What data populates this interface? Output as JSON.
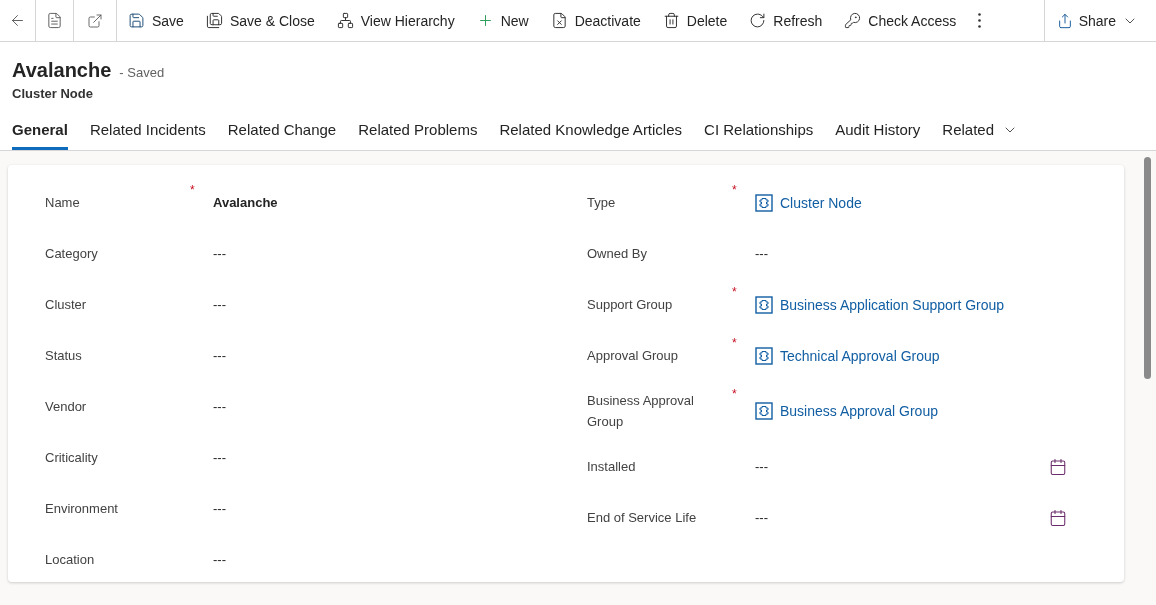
{
  "toolbar": {
    "items": [
      {
        "label": "Save"
      },
      {
        "label": "Save & Close"
      },
      {
        "label": "View Hierarchy"
      },
      {
        "label": "New"
      },
      {
        "label": "Deactivate"
      },
      {
        "label": "Delete"
      },
      {
        "label": "Refresh"
      },
      {
        "label": "Check Access"
      }
    ],
    "share": "Share"
  },
  "header": {
    "title": "Avalanche",
    "status": "- Saved",
    "entity": "Cluster Node"
  },
  "tabs": [
    {
      "label": "General",
      "selected": true
    },
    {
      "label": "Related Incidents",
      "selected": false
    },
    {
      "label": "Related Change",
      "selected": false
    },
    {
      "label": "Related Problems",
      "selected": false
    },
    {
      "label": "Related Knowledge Articles",
      "selected": false
    },
    {
      "label": "CI Relationships",
      "selected": false
    },
    {
      "label": "Audit History",
      "selected": false
    },
    {
      "label": "Related",
      "selected": false,
      "kind": "dropdown"
    }
  ],
  "form": {
    "left": [
      {
        "label": "Name",
        "marker": "*",
        "value": "Avalanche",
        "kind": "text"
      },
      {
        "label": "Category",
        "value": "---",
        "kind": "text"
      },
      {
        "label": "Cluster",
        "value": "---",
        "kind": "text"
      },
      {
        "label": "Status",
        "value": "---",
        "kind": "text"
      },
      {
        "label": "Vendor",
        "value": "---",
        "kind": "text"
      },
      {
        "label": "Criticality",
        "value": "---",
        "kind": "text"
      },
      {
        "label": "Environment",
        "value": "---",
        "kind": "text"
      },
      {
        "label": "Location",
        "value": "---",
        "kind": "text"
      }
    ],
    "right": [
      {
        "label": "Type",
        "marker": "*",
        "value": "Cluster Node",
        "kind": "lookup"
      },
      {
        "label": "Owned By",
        "value": "---",
        "kind": "text"
      },
      {
        "label": "Support Group",
        "marker": "*",
        "value": "Business Application Support Group",
        "kind": "lookup"
      },
      {
        "label": "Approval Group",
        "marker": "*",
        "value": "Technical Approval Group",
        "kind": "lookup"
      },
      {
        "label": "Business Approval Group",
        "marker": "*",
        "value": "Business Approval Group",
        "kind": "lookup"
      },
      {
        "label": "Installed",
        "value": "---",
        "kind": "date"
      },
      {
        "label": "End of Service Life",
        "value": "---",
        "kind": "date"
      }
    ]
  }
}
